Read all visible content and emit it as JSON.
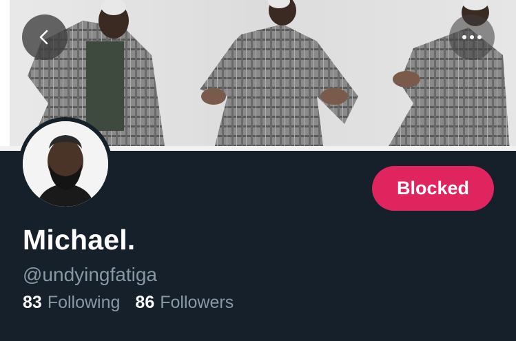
{
  "header": {
    "back_icon": "chevron-left-icon",
    "more_icon": "more-dots-icon"
  },
  "profile": {
    "display_name": "Michael.",
    "handle": "@undyingfatiga",
    "blocked_label": "Blocked",
    "stats": {
      "following_count": "83",
      "following_label": "Following",
      "followers_count": "86",
      "followers_label": "Followers"
    }
  },
  "colors": {
    "background": "#15202b",
    "blocked_button": "#e0245e",
    "secondary_text": "#8899a6",
    "primary_text": "#ffffff"
  }
}
